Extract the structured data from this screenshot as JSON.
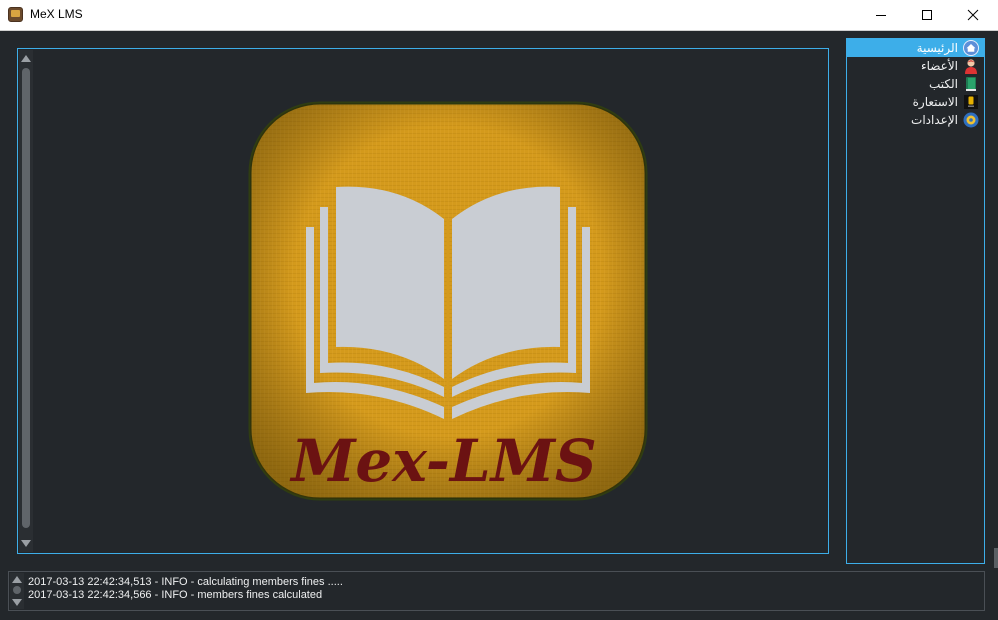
{
  "window": {
    "title": "MeX LMS",
    "controls": [
      "minimize-icon",
      "maximize-icon",
      "close-icon"
    ]
  },
  "logo": {
    "text": "Mex-LMS",
    "icon": "open-book-logo",
    "colors": {
      "background": "#d59a1a",
      "book": "#c8ccd3",
      "text": "#6b1212",
      "border": "#2b3b10"
    }
  },
  "sidebar": {
    "items": [
      {
        "label": "الرئيسية",
        "icon": "home-icon",
        "active": true
      },
      {
        "label": "الأعضاء",
        "icon": "member-icon",
        "active": false
      },
      {
        "label": "الكتب",
        "icon": "book-icon",
        "active": false
      },
      {
        "label": "الاستعارة",
        "icon": "borrow-icon",
        "active": false
      },
      {
        "label": "الإعدادات",
        "icon": "settings-icon",
        "active": false
      }
    ]
  },
  "log": {
    "lines": [
      "2017-03-13 22:42:34,513 - INFO - calculating members fines .....",
      "2017-03-13 22:42:34,566 - INFO - members fines calculated"
    ]
  },
  "colors": {
    "accent": "#3daee9",
    "background": "#23272b",
    "text": "#eff0f1"
  }
}
